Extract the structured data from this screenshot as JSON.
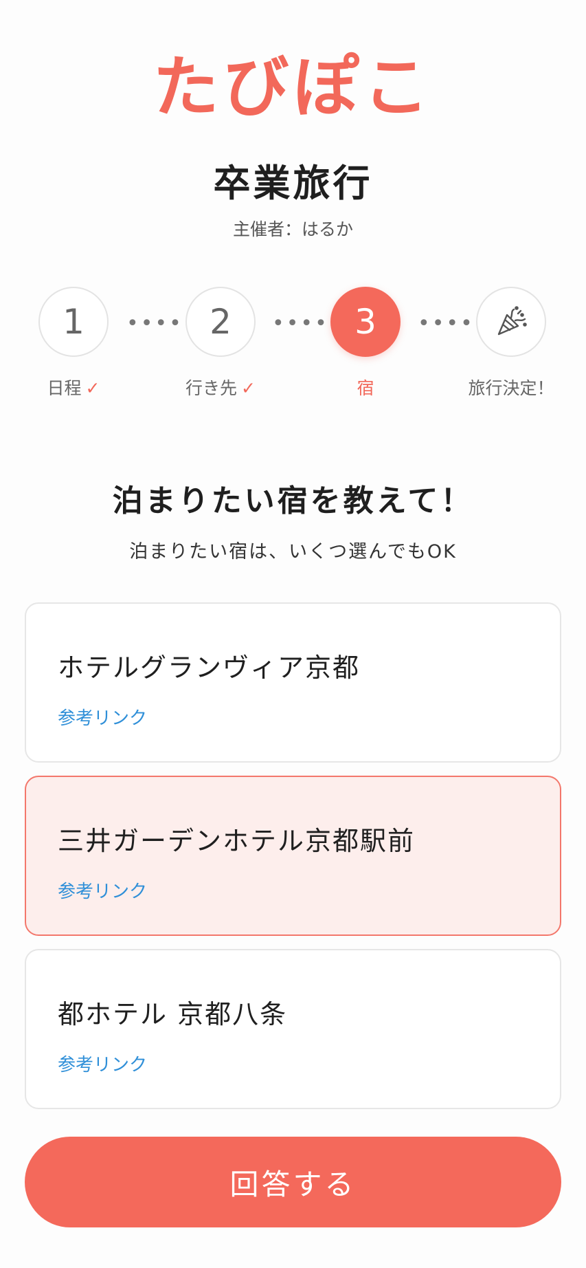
{
  "app": {
    "logo": "たびぽこ"
  },
  "trip": {
    "title": "卒業旅行",
    "organizer": "主催者：はるか"
  },
  "steps": [
    {
      "number": "1",
      "label": "日程",
      "done": true
    },
    {
      "number": "2",
      "label": "行き先",
      "done": true
    },
    {
      "number": "3",
      "label": "宿",
      "active": true
    },
    {
      "icon": "party-popper-icon",
      "label": "旅行決定！"
    }
  ],
  "step_connector": "••••",
  "check_mark": "✓",
  "question": {
    "title": "泊まりたい宿を教えて！",
    "subtitle": "泊まりたい宿は、いくつ選んでもOK"
  },
  "hotels": [
    {
      "name": "ホテルグランヴィア京都",
      "link_label": "参考リンク",
      "selected": false
    },
    {
      "name": "三井ガーデンホテル京都駅前",
      "link_label": "参考リンク",
      "selected": true
    },
    {
      "name": "都ホテル 京都八条",
      "link_label": "参考リンク",
      "selected": false
    }
  ],
  "submit": {
    "label": "回答する"
  },
  "colors": {
    "accent": "#f4695b",
    "selected_bg": "#fdeeec",
    "link": "#2f8fd8"
  }
}
